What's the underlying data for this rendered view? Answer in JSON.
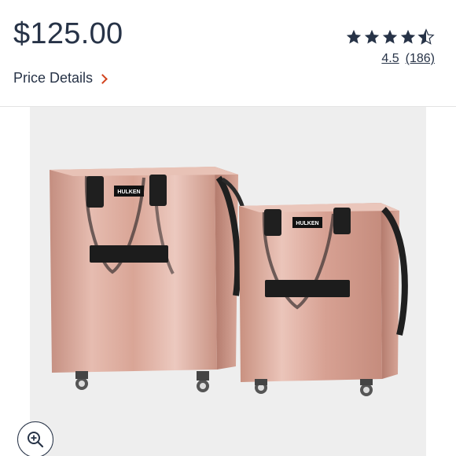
{
  "product": {
    "price": "$125.00",
    "price_details_label": "Price Details",
    "rating_value": "4.5",
    "review_count": "(186)",
    "rating_stars": 4.5,
    "brand_label": "HULKEN"
  },
  "colors": {
    "text": "#273347",
    "accent_chevron": "#d2421c",
    "bag_rose_gold": "#d8a597",
    "handle_black": "#1f1f1f"
  },
  "icons": {
    "star": "star-icon",
    "zoom": "zoom-in-icon",
    "chevron": "chevron-right-icon"
  }
}
